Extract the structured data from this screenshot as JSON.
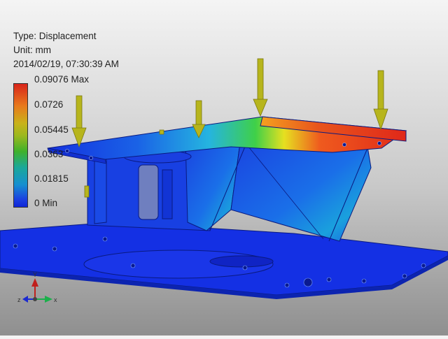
{
  "info": {
    "type": "Type: Displacement",
    "unit": "Unit: mm",
    "datetime": "2014/02/19, 07:30:39 AM"
  },
  "legend": {
    "labels": [
      "0.09076 Max",
      "0.0726",
      "0.05445",
      "0.0363",
      "0.01815",
      "0 Min"
    ]
  },
  "triad": {
    "x_label": "x",
    "y_label": "Y",
    "z_label": "z"
  },
  "colors": {
    "max_red": "#d8241a",
    "mid_green": "#3fb12b",
    "min_blue": "#1026d8",
    "load_arrow": "#b7b51c",
    "axis_x": "#1bb04b",
    "axis_y": "#c0201d",
    "axis_z": "#1b2ad0"
  }
}
